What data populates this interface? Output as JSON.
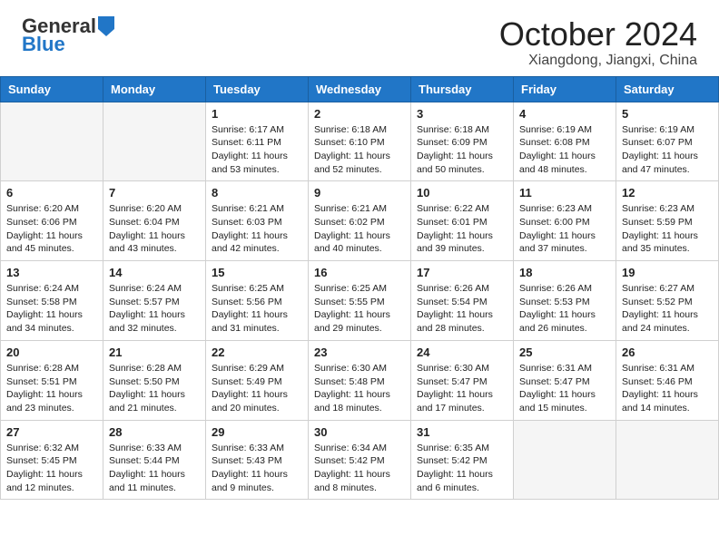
{
  "header": {
    "logo_general": "General",
    "logo_blue": "Blue",
    "month": "October 2024",
    "location": "Xiangdong, Jiangxi, China"
  },
  "days_of_week": [
    "Sunday",
    "Monday",
    "Tuesday",
    "Wednesday",
    "Thursday",
    "Friday",
    "Saturday"
  ],
  "weeks": [
    [
      {
        "day": "",
        "empty": true
      },
      {
        "day": "",
        "empty": true
      },
      {
        "day": "1",
        "sunrise": "6:17 AM",
        "sunset": "6:11 PM",
        "daylight": "11 hours and 53 minutes."
      },
      {
        "day": "2",
        "sunrise": "6:18 AM",
        "sunset": "6:10 PM",
        "daylight": "11 hours and 52 minutes."
      },
      {
        "day": "3",
        "sunrise": "6:18 AM",
        "sunset": "6:09 PM",
        "daylight": "11 hours and 50 minutes."
      },
      {
        "day": "4",
        "sunrise": "6:19 AM",
        "sunset": "6:08 PM",
        "daylight": "11 hours and 48 minutes."
      },
      {
        "day": "5",
        "sunrise": "6:19 AM",
        "sunset": "6:07 PM",
        "daylight": "11 hours and 47 minutes."
      }
    ],
    [
      {
        "day": "6",
        "sunrise": "6:20 AM",
        "sunset": "6:06 PM",
        "daylight": "11 hours and 45 minutes."
      },
      {
        "day": "7",
        "sunrise": "6:20 AM",
        "sunset": "6:04 PM",
        "daylight": "11 hours and 43 minutes."
      },
      {
        "day": "8",
        "sunrise": "6:21 AM",
        "sunset": "6:03 PM",
        "daylight": "11 hours and 42 minutes."
      },
      {
        "day": "9",
        "sunrise": "6:21 AM",
        "sunset": "6:02 PM",
        "daylight": "11 hours and 40 minutes."
      },
      {
        "day": "10",
        "sunrise": "6:22 AM",
        "sunset": "6:01 PM",
        "daylight": "11 hours and 39 minutes."
      },
      {
        "day": "11",
        "sunrise": "6:23 AM",
        "sunset": "6:00 PM",
        "daylight": "11 hours and 37 minutes."
      },
      {
        "day": "12",
        "sunrise": "6:23 AM",
        "sunset": "5:59 PM",
        "daylight": "11 hours and 35 minutes."
      }
    ],
    [
      {
        "day": "13",
        "sunrise": "6:24 AM",
        "sunset": "5:58 PM",
        "daylight": "11 hours and 34 minutes."
      },
      {
        "day": "14",
        "sunrise": "6:24 AM",
        "sunset": "5:57 PM",
        "daylight": "11 hours and 32 minutes."
      },
      {
        "day": "15",
        "sunrise": "6:25 AM",
        "sunset": "5:56 PM",
        "daylight": "11 hours and 31 minutes."
      },
      {
        "day": "16",
        "sunrise": "6:25 AM",
        "sunset": "5:55 PM",
        "daylight": "11 hours and 29 minutes."
      },
      {
        "day": "17",
        "sunrise": "6:26 AM",
        "sunset": "5:54 PM",
        "daylight": "11 hours and 28 minutes."
      },
      {
        "day": "18",
        "sunrise": "6:26 AM",
        "sunset": "5:53 PM",
        "daylight": "11 hours and 26 minutes."
      },
      {
        "day": "19",
        "sunrise": "6:27 AM",
        "sunset": "5:52 PM",
        "daylight": "11 hours and 24 minutes."
      }
    ],
    [
      {
        "day": "20",
        "sunrise": "6:28 AM",
        "sunset": "5:51 PM",
        "daylight": "11 hours and 23 minutes."
      },
      {
        "day": "21",
        "sunrise": "6:28 AM",
        "sunset": "5:50 PM",
        "daylight": "11 hours and 21 minutes."
      },
      {
        "day": "22",
        "sunrise": "6:29 AM",
        "sunset": "5:49 PM",
        "daylight": "11 hours and 20 minutes."
      },
      {
        "day": "23",
        "sunrise": "6:30 AM",
        "sunset": "5:48 PM",
        "daylight": "11 hours and 18 minutes."
      },
      {
        "day": "24",
        "sunrise": "6:30 AM",
        "sunset": "5:47 PM",
        "daylight": "11 hours and 17 minutes."
      },
      {
        "day": "25",
        "sunrise": "6:31 AM",
        "sunset": "5:47 PM",
        "daylight": "11 hours and 15 minutes."
      },
      {
        "day": "26",
        "sunrise": "6:31 AM",
        "sunset": "5:46 PM",
        "daylight": "11 hours and 14 minutes."
      }
    ],
    [
      {
        "day": "27",
        "sunrise": "6:32 AM",
        "sunset": "5:45 PM",
        "daylight": "11 hours and 12 minutes."
      },
      {
        "day": "28",
        "sunrise": "6:33 AM",
        "sunset": "5:44 PM",
        "daylight": "11 hours and 11 minutes."
      },
      {
        "day": "29",
        "sunrise": "6:33 AM",
        "sunset": "5:43 PM",
        "daylight": "11 hours and 9 minutes."
      },
      {
        "day": "30",
        "sunrise": "6:34 AM",
        "sunset": "5:42 PM",
        "daylight": "11 hours and 8 minutes."
      },
      {
        "day": "31",
        "sunrise": "6:35 AM",
        "sunset": "5:42 PM",
        "daylight": "11 hours and 6 minutes."
      },
      {
        "day": "",
        "empty": true
      },
      {
        "day": "",
        "empty": true
      }
    ]
  ]
}
